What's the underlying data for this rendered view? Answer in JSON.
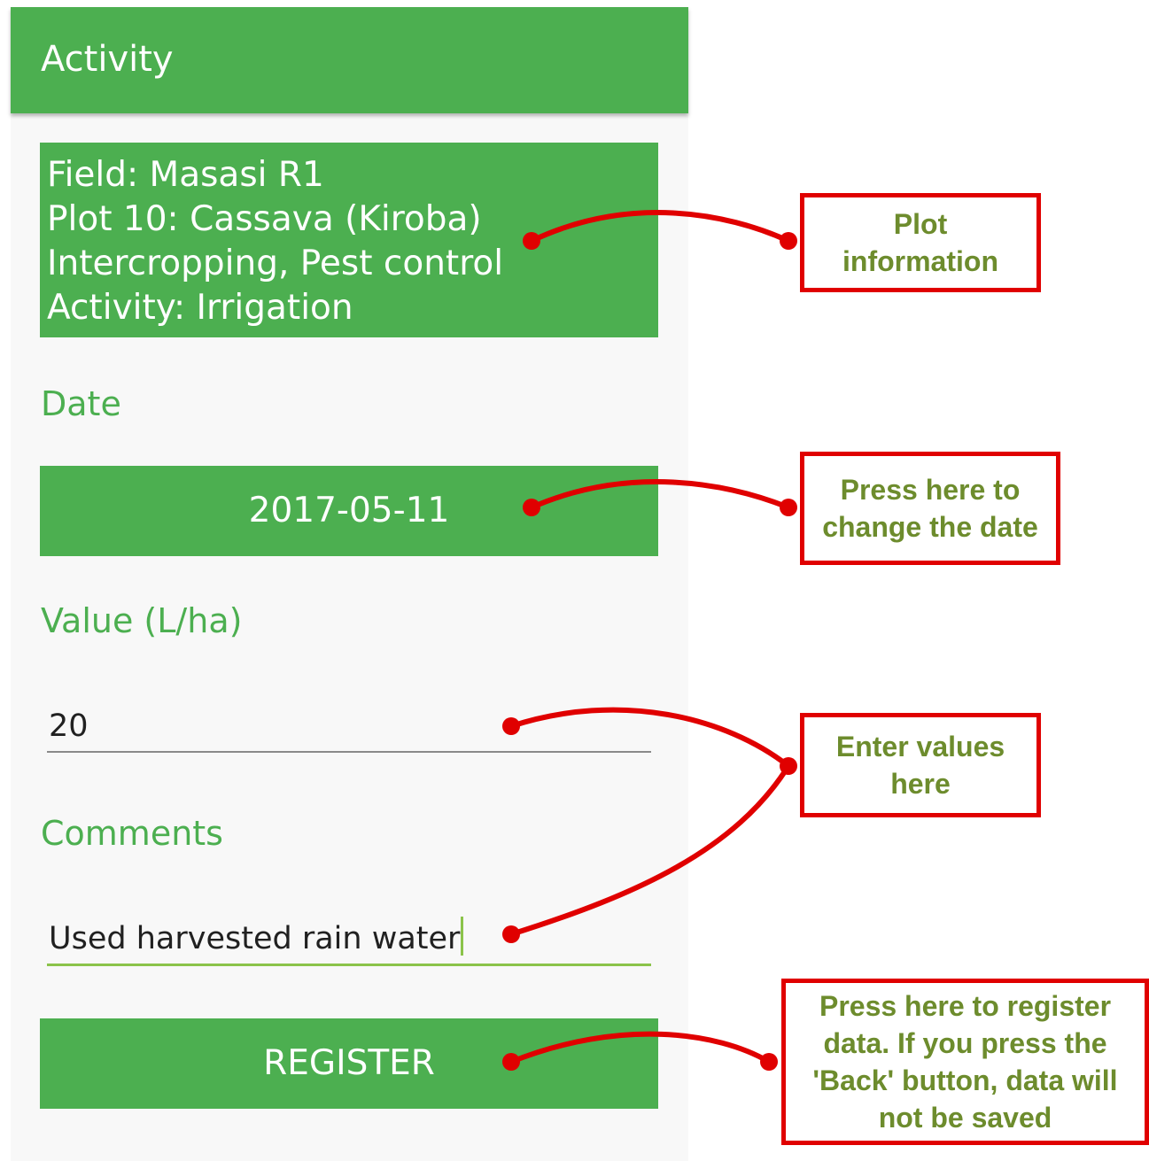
{
  "app_bar": {
    "title": "Activity"
  },
  "plot_info": {
    "lines": [
      "Field: Masasi R1",
      "Plot 10: Cassava (Kiroba)",
      "Intercropping, Pest control",
      "Activity: Irrigation"
    ]
  },
  "date": {
    "label": "Date",
    "value": "2017-05-11"
  },
  "value_field": {
    "label": "Value (L/ha)",
    "value": "20"
  },
  "comments_field": {
    "label": "Comments",
    "value": "Used harvested rain water"
  },
  "register_button": {
    "label": "REGISTER"
  },
  "annotations": {
    "plot_information": "Plot information",
    "change_date": "Press here to change the date",
    "enter_values": "Enter values here",
    "register_data": "Press here to register data. If you press the 'Back' button, data will not be saved"
  },
  "colors": {
    "primary_green": "#4caf50",
    "accent_green": "#8bc34a",
    "annotation_red": "#e00000",
    "annotation_text": "#6d8c2d"
  }
}
